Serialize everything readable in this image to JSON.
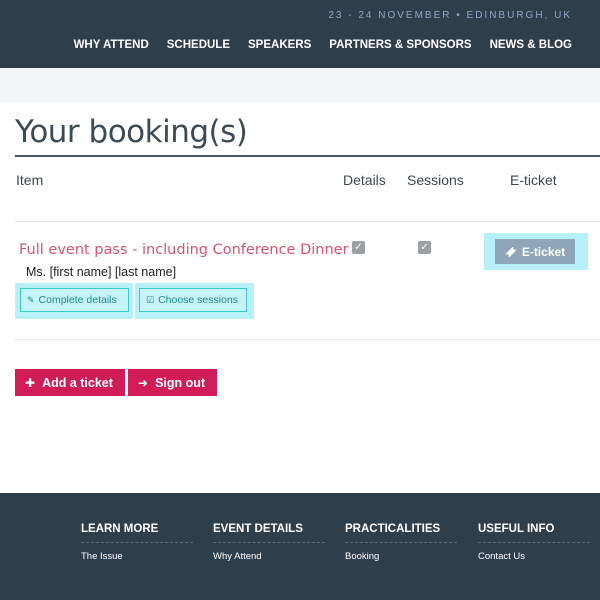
{
  "header": {
    "dates": "23 - 24 NOVEMBER • EDINBURGH, UK",
    "nav": [
      "WHY ATTEND",
      "SCHEDULE",
      "SPEAKERS",
      "PARTNERS & SPONSORS",
      "NEWS & BLOG"
    ]
  },
  "page": {
    "title": "Your booking(s)"
  },
  "table": {
    "columns": {
      "item": "Item",
      "details": "Details",
      "sessions": "Sessions",
      "eticket": "E-ticket"
    },
    "rows": [
      {
        "item_name": "Full event pass - including Conference Dinner",
        "attendee": "Ms. [first name] [last name]",
        "details_done": true,
        "sessions_done": true,
        "complete_details_label": "Complete details",
        "choose_sessions_label": "Choose sessions",
        "eticket_label": "E-ticket"
      }
    ]
  },
  "actions": {
    "add_ticket_label": "Add a ticket",
    "sign_out_label": "Sign out"
  },
  "footer": {
    "columns": [
      {
        "heading": "LEARN MORE",
        "link": "The Issue"
      },
      {
        "heading": "EVENT DETAILS",
        "link": "Why Attend"
      },
      {
        "heading": "PRACTICALITIES",
        "link": "Booking"
      },
      {
        "heading": "USEFUL INFO",
        "link": "Contact Us"
      }
    ]
  },
  "colors": {
    "header_bg": "#2f3e4b",
    "accent": "#d01c57",
    "item_link": "#d9546e",
    "highlight": "#b7f0f6",
    "eticket_button": "#8fa6b8"
  },
  "icons": {
    "complete_details": "edit-icon",
    "choose_sessions": "checkbox-edit-icon",
    "eticket": "ticket-icon",
    "add_ticket": "plus-icon",
    "sign_out": "sign-out-icon",
    "checked": "checked-box-icon"
  }
}
